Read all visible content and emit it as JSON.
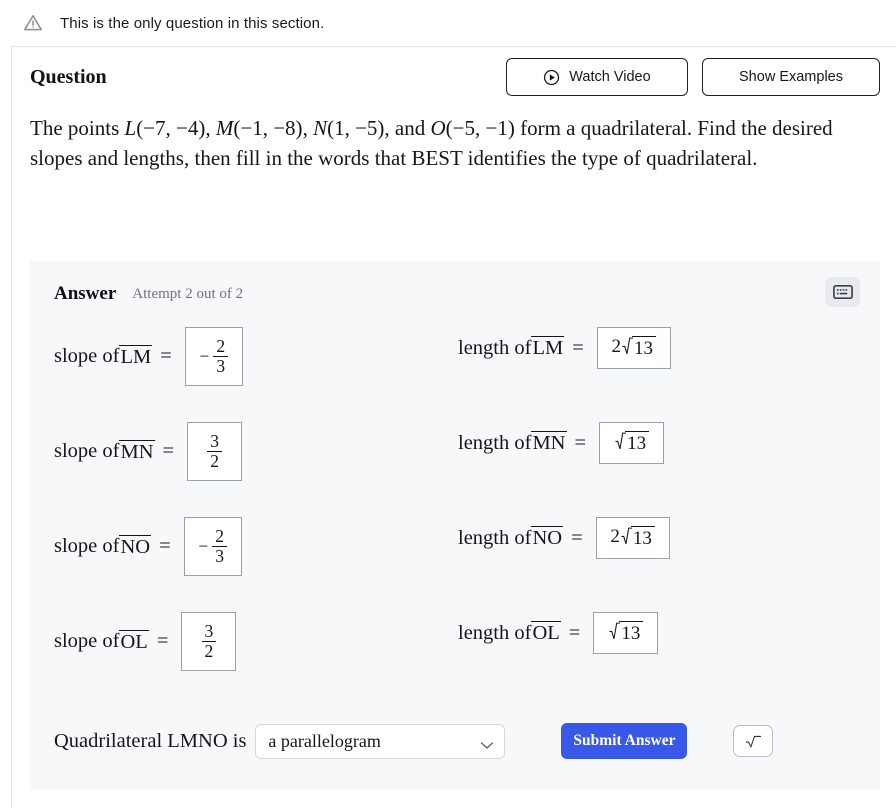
{
  "notice": {
    "icon": "warning-triangle-icon",
    "text": "This is the only question in this section."
  },
  "question": {
    "title": "Question",
    "watch_video_label": "Watch Video",
    "watch_video_icon": "play-circle-icon",
    "show_examples_label": "Show Examples",
    "statement_line1_a": "The points ",
    "statement_points": [
      {
        "name": "L",
        "coords": "(−7, −4)",
        "sep": ", "
      },
      {
        "name": "M",
        "coords": "(−1, −8)",
        "sep": ", "
      },
      {
        "name": "N",
        "coords": "(1, −5)",
        "sep": ", and "
      },
      {
        "name": "O",
        "coords": "(−5, −1)",
        "sep": " "
      }
    ],
    "statement_tail": "form a quadrilateral. Find the desired slopes and lengths, then fill in the words that BEST identifies the type of quadrilateral."
  },
  "answer": {
    "label": "Answer",
    "attempt": "Attempt 2 out of 2",
    "keyboard_icon": "keyboard-icon",
    "rows": [
      {
        "slope_prefix": "slope of ",
        "segment": "LM",
        "slope_eq": " = ",
        "slope_sign": "−",
        "slope_num": "2",
        "slope_den": "3",
        "length_prefix": "length of ",
        "length_eq": " = ",
        "length_coef": "2",
        "length_radicand": "13"
      },
      {
        "slope_prefix": "slope of ",
        "segment": "MN",
        "slope_eq": " = ",
        "slope_sign": "",
        "slope_num": "3",
        "slope_den": "2",
        "length_prefix": "length of ",
        "length_eq": " = ",
        "length_coef": "",
        "length_radicand": "13"
      },
      {
        "slope_prefix": "slope of ",
        "segment": "NO",
        "slope_eq": " = ",
        "slope_sign": "−",
        "slope_num": "2",
        "slope_den": "3",
        "length_prefix": "length of ",
        "length_eq": " = ",
        "length_coef": "2",
        "length_radicand": "13"
      },
      {
        "slope_prefix": "slope of ",
        "segment": "OL",
        "slope_eq": " = ",
        "slope_sign": "",
        "slope_num": "3",
        "slope_den": "2",
        "length_prefix": "length of ",
        "length_eq": " = ",
        "length_coef": "",
        "length_radicand": "13"
      }
    ],
    "conclusion_label": "Quadrilateral LMNO is",
    "conclusion_value": "a parallelogram",
    "conclusion_chevron": "chevron-down-icon",
    "submit_label": "Submit Answer",
    "sqrt_button_icon": "radical-icon"
  },
  "colors": {
    "accent_blue": "#3758e8",
    "panel_bg": "#f7f8fa",
    "divider": "#e3e5ea",
    "text": "#16161a",
    "muted_text": "#6f737d",
    "input_border": "#9aa0ab"
  }
}
